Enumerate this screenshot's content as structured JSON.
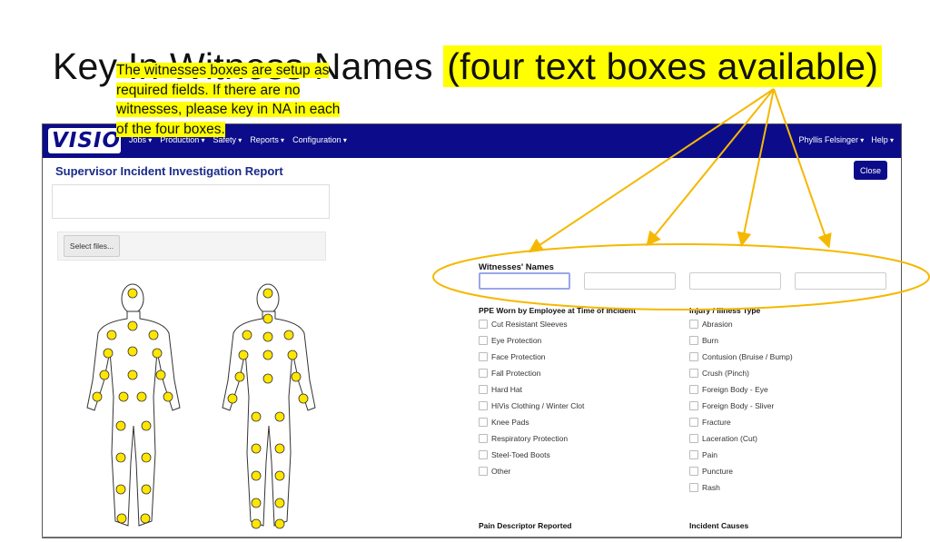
{
  "slide": {
    "title_main": "Key In Witness Names",
    "title_note": "(four text boxes available)"
  },
  "navbar": {
    "logo_text": "VISION",
    "logo_tag": "",
    "menus": [
      "Jobs",
      "Production",
      "Safety",
      "Reports",
      "Configuration"
    ],
    "user": "Phyllis Felsinger",
    "help": "Help"
  },
  "report": {
    "title": "Supervisor Incident Investigation Report",
    "close_label": "Close"
  },
  "upload": {
    "select_label": "Select files..."
  },
  "note_lines": [
    "The witnesses boxes are setup as",
    "required fields. If there are no",
    "witnesses, please key in NA in each",
    "of the four boxes."
  ],
  "witnesses": {
    "label": "Witnesses' Names",
    "values": [
      "",
      "",
      "",
      ""
    ]
  },
  "ppe": {
    "heading": "PPE Worn by Employee at Time of Incident",
    "items": [
      "Cut Resistant Sleeves",
      "Eye Protection",
      "Face Protection",
      "Fall Protection",
      "Hard Hat",
      "HiVis Clothing / Winter Clot",
      "Knee Pads",
      "Respiratory Protection",
      "Steel-Toed Boots",
      "Other"
    ]
  },
  "injury": {
    "heading": "Injury / Illness Type",
    "items": [
      "Abrasion",
      "Burn",
      "Contusion (Bruise / Bump)",
      "Crush (Pinch)",
      "Foreign Body - Eye",
      "Foreign Body - Sliver",
      "Fracture",
      "Laceration (Cut)",
      "Pain",
      "Puncture",
      "Rash"
    ]
  },
  "pain": {
    "heading": "Pain Descriptor Reported"
  },
  "causes": {
    "heading": "Incident Causes"
  },
  "colors": {
    "navbar": "#0c0c8a",
    "highlight": "#ffff00",
    "annotation": "#f5b800",
    "marker": "#ffe600"
  }
}
